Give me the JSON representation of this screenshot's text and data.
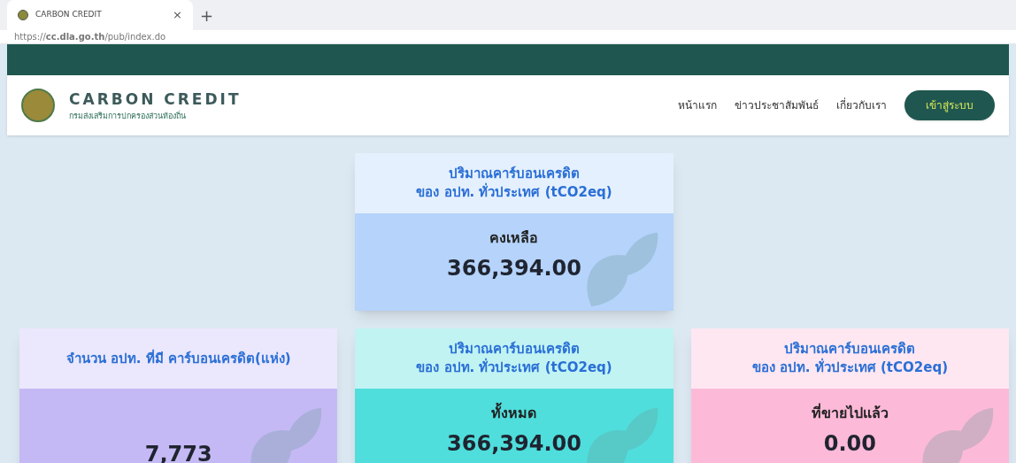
{
  "browser": {
    "tab": {
      "title": "CARBON CREDIT",
      "close": "×",
      "selected": true
    },
    "new_tab": "+",
    "url": "https://**cc.dla.go.th**/pub/index.do"
  },
  "header": {
    "brand": "CARBON CREDIT",
    "subtitle": "กรมส่งเสริมการปกครองส่วนท้องถิ่น",
    "nav": [
      {
        "label": "หน้าแรก"
      },
      {
        "label": "ข่าวประชาสัมพันธ์"
      },
      {
        "label": "เกี่ยวกับเรา"
      }
    ],
    "login_button": "เข้าสู่ระบบ"
  },
  "cards": [
    {
      "title": [
        "ปริมาณคาร์บอนเครดิต",
        "ของ อปท. ทั่วประเทศ (tCO2eq)"
      ],
      "label": "คงเหลือ",
      "value": "366,394.00",
      "color": "#b5d3fb"
    },
    {
      "title": [
        "จำนวน อปท. ที่มี คาร์บอนเครดิต(แห่ง)"
      ],
      "value": "7,773",
      "color": "#c5b9f5"
    },
    {
      "title": [
        "ปริมาณคาร์บอนเครดิต",
        "ของ อปท. ทั่วประเทศ (tCO2eq)"
      ],
      "label": "ทั้งหมด",
      "value": "366,394.00",
      "color": "#4fdedc"
    },
    {
      "title": [
        "ปริมาณคาร์บอนเครดิต",
        "ของ อปท. ทั่วประเทศ (tCO2eq)"
      ],
      "label": "ที่ขายไปแล้ว",
      "value": "0.00",
      "color": "#fdb9d8"
    }
  ]
}
